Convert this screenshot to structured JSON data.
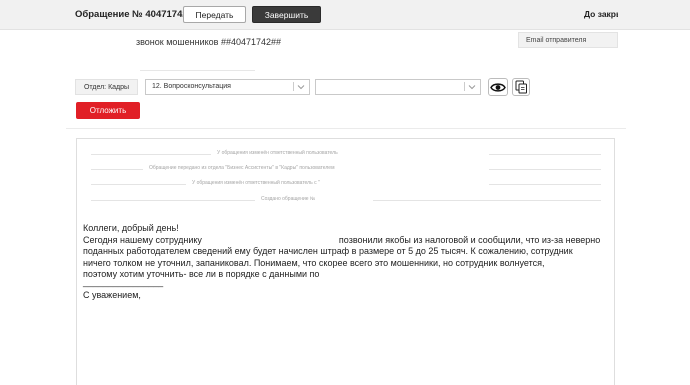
{
  "header": {
    "ticket_title": "Обращение № 40471742",
    "transfer_label": "Передать",
    "complete_label": "Завершить",
    "until_close": "До закрытия"
  },
  "subject": {
    "text": "звонок мошенников ##40471742##"
  },
  "sender": {
    "email_label": "Email отправителя"
  },
  "routing": {
    "department_label": "Отдел: Кадры",
    "category_value": "12. Вопросконсультация",
    "subcategory_value": "",
    "postpone_label": "Отложить"
  },
  "history": [
    "У обращения изменён ответственный пользователь",
    "Обращение передано из отдела \"Бизнес Ассистенты\" в \"Кадры\" пользователем",
    "У обращения изменён ответственный пользователь с \"",
    "Создано обращение №"
  ],
  "message": {
    "greeting": "Коллеги, добрый день!",
    "line1_start": "Сегодня нашему сотруднику",
    "line1_end": "позвонили якобы из налоговой и сообщили, что из-за неверно",
    "line2": "поданных работодателем сведений ему будет начислен штраф в размере от 5 до 25 тысяч. К сожалению, сотрудник",
    "line3": "ничего толком не уточнил, запаниковал. Понимаем, что скорее всего это мошенники, но сотрудник волнуется,",
    "line4": "поэтому хотим уточнить- все ли в порядке с данными по",
    "separator": "________________",
    "closing": "С уважением,"
  },
  "icons": {
    "eye": "eye-icon",
    "copy": "copy-document-icon",
    "dropdown": "chevron-down-icon"
  },
  "colors": {
    "accent_red": "#e11f26",
    "dark_button": "#3a3a3a",
    "topbar_bg": "#f1f1f1"
  }
}
